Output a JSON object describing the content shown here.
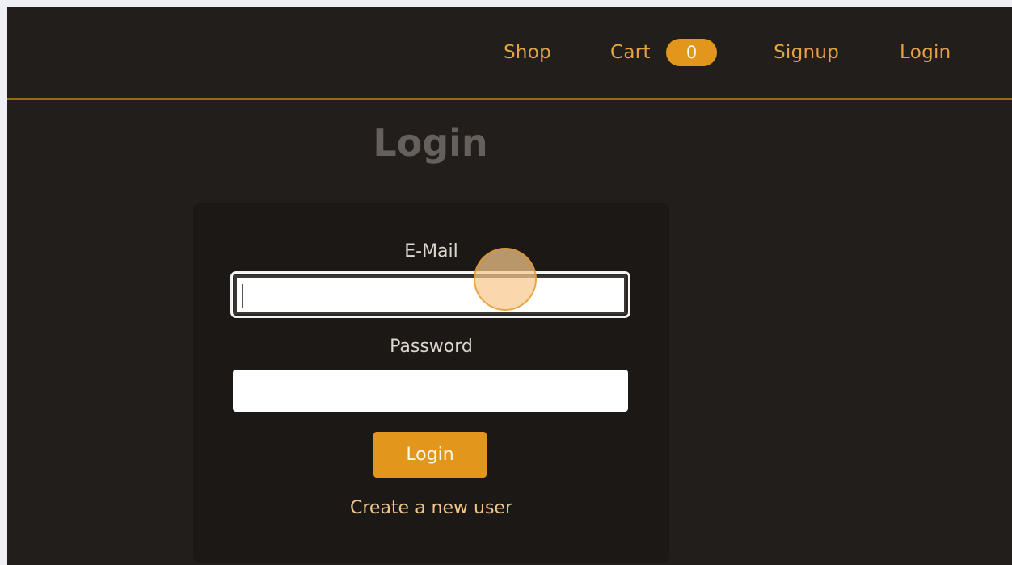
{
  "navbar": {
    "items": [
      {
        "label": "Shop"
      },
      {
        "label": "Cart"
      },
      {
        "label": "Signup"
      },
      {
        "label": "Login"
      }
    ],
    "cart_count": "0"
  },
  "page": {
    "title": "Login"
  },
  "form": {
    "email_label": "E-Mail",
    "email_value": "",
    "password_label": "Password",
    "password_value": "",
    "submit_label": "Login",
    "create_user_link": "Create a new user"
  },
  "colors": {
    "accent": "#e2961c",
    "background": "#221e1c",
    "card": "#1b1816",
    "nav_text": "#e3a246"
  }
}
